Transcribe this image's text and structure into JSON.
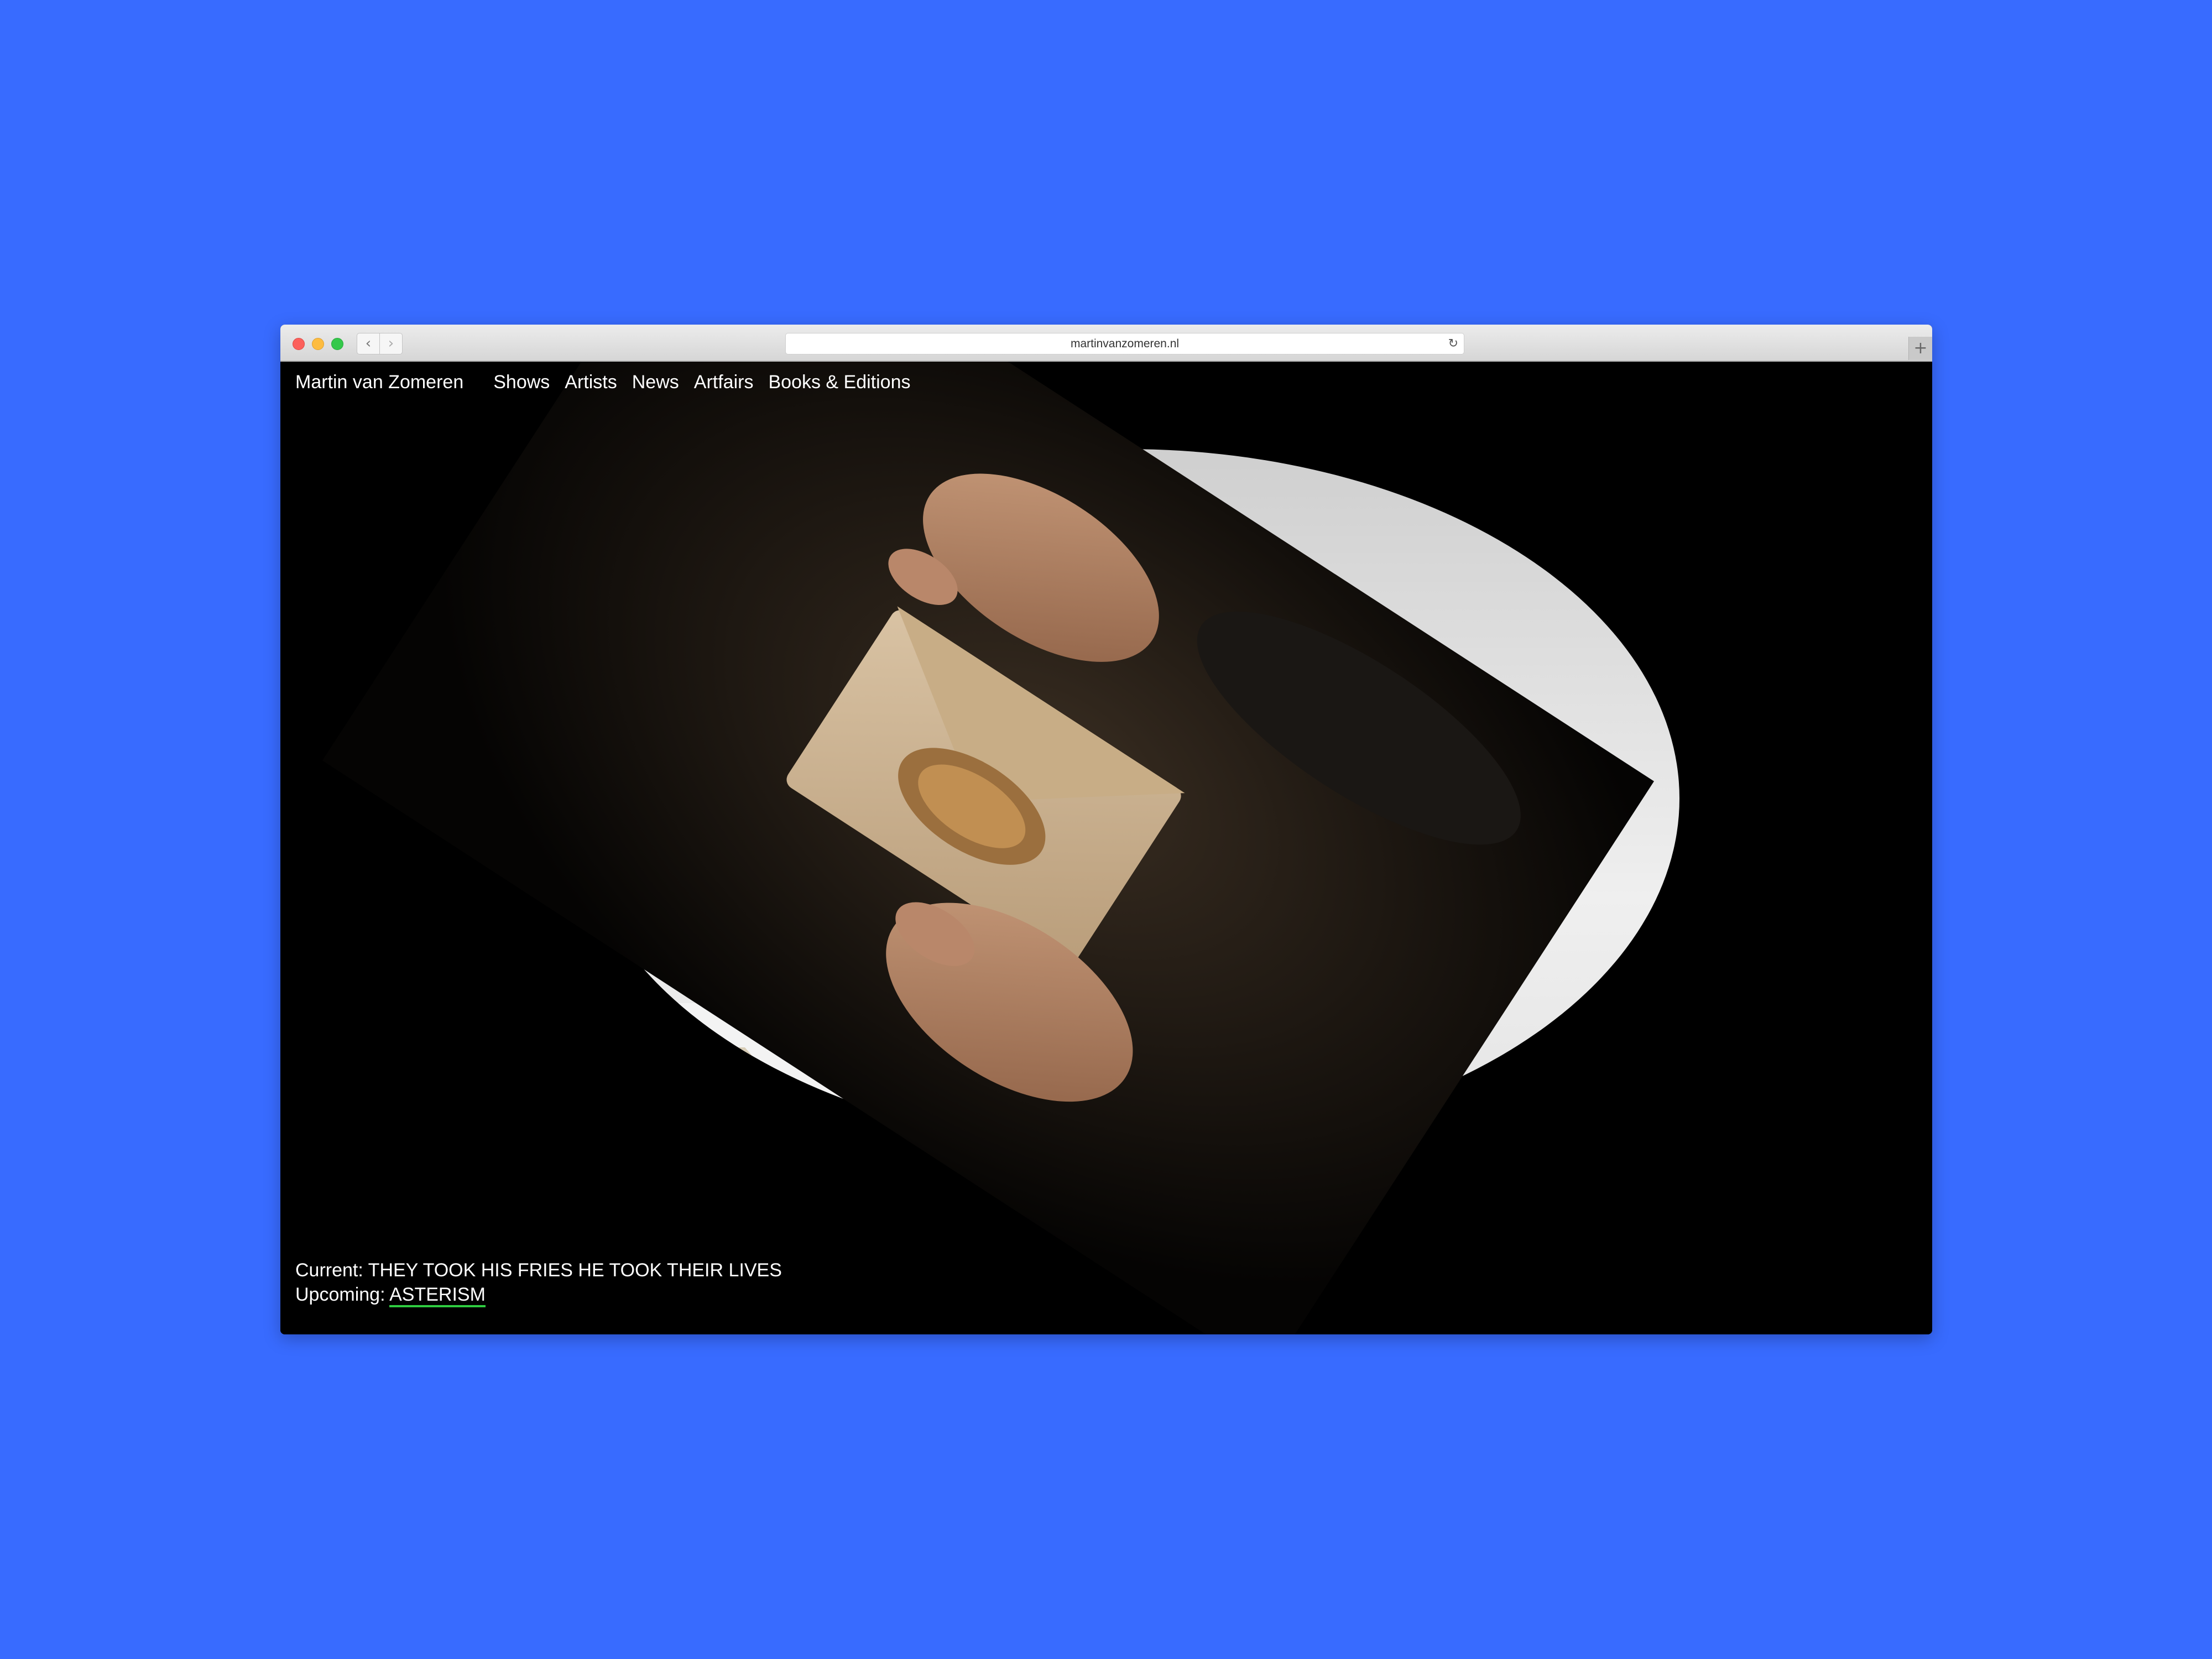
{
  "browser": {
    "url": "martinvanzomeren.nl",
    "reload_icon": "↻",
    "back_icon": "‹",
    "forward_icon": "›",
    "new_tab_icon": "+"
  },
  "site": {
    "brand": "Martin van Zomeren",
    "nav": [
      "Shows",
      "Artists",
      "News",
      "Artfairs",
      "Books & Editions"
    ]
  },
  "exhibitions": {
    "current_label": "Current:",
    "current_title": "THEY TOOK HIS FRIES HE TOOK THEIR LIVES",
    "upcoming_label": "Upcoming:",
    "upcoming_title": "ASTERISM"
  },
  "colors": {
    "background": "#386bff",
    "page": "#000000",
    "link_underline": "#2ecc40"
  }
}
